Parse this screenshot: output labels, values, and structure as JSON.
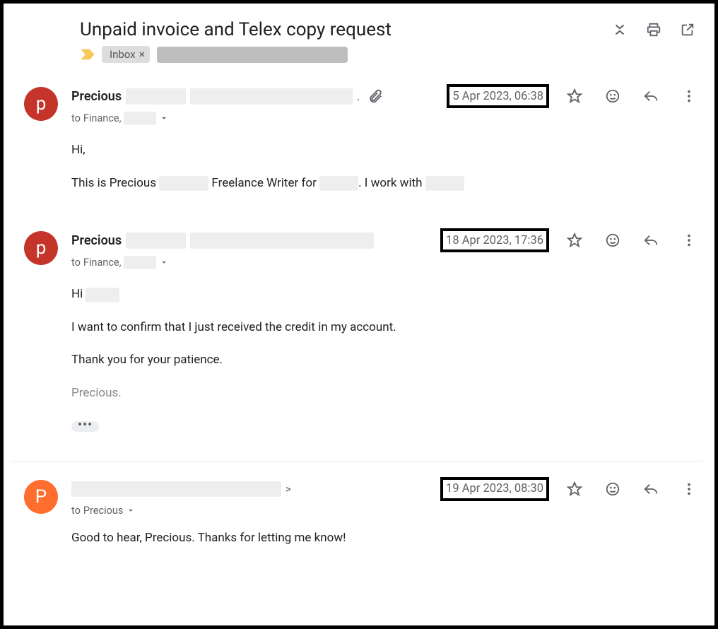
{
  "subject": "Unpaid invoice and Telex copy request",
  "labels": {
    "inbox": "Inbox"
  },
  "messages": [
    {
      "avatar_letter": "p",
      "sender": "Precious",
      "timestamp": "5 Apr 2023, 06:38",
      "to_prefix": "to ",
      "to_value": "Finance,",
      "has_attachment": true,
      "body_hi": "Hi,",
      "body_l1a": "This is Precious ",
      "body_l1b": " Freelance Writer for ",
      "body_l1c": ". I work with "
    },
    {
      "avatar_letter": "p",
      "sender": "Precious",
      "timestamp": "18 Apr 2023, 17:36",
      "to_prefix": "to ",
      "to_value": "Finance, ",
      "body_hi": "Hi ",
      "body_p1": "I want to confirm that I just received the credit in my account.",
      "body_p2": "Thank you for your patience.",
      "body_sig": "Precious."
    },
    {
      "avatar_letter": "P",
      "sender_angle": ">",
      "timestamp": "19 Apr 2023, 08:30",
      "to_prefix": "to ",
      "to_value": "Precious",
      "body_p1": "Good to hear, Precious. Thanks for letting me know!"
    }
  ]
}
